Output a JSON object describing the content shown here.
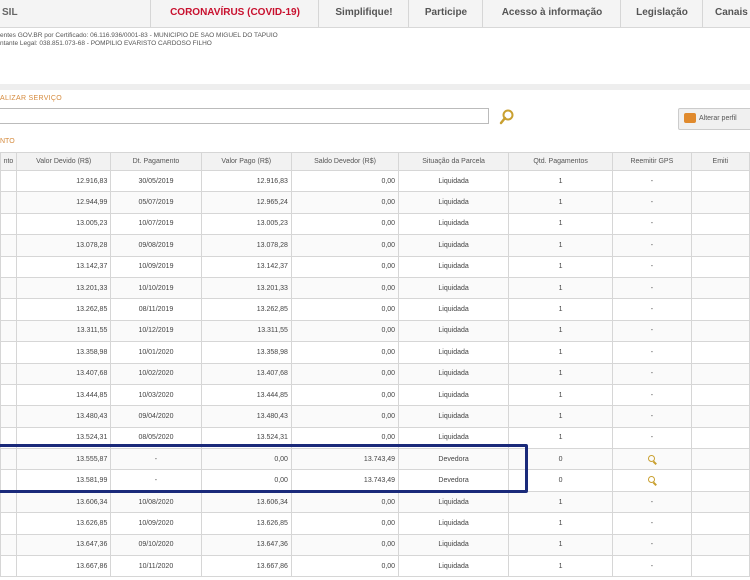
{
  "nav": {
    "brasil": "SIL",
    "coronavirus": "CORONAVÍRUS (COVID-19)",
    "simplifique": "Simplifique!",
    "participe": "Participe",
    "acesso": "Acesso à informação",
    "legislacao": "Legislação",
    "canais": "Canais"
  },
  "certificate": {
    "line1": "entes GOV.BR por Certificado: 06.116.936/0001-83 - MUNICIPIO DE SAO MIGUEL DO TAPUIO",
    "line2": "ntante Legal: 038.851.073-68 - POMPILIO EVARISTO CARDOSO FILHO"
  },
  "section_title": "ALIZAR SERVIÇO",
  "search": {
    "value": "",
    "placeholder": ""
  },
  "alter_button_label": "Alterar perfil",
  "section_sub": "NTO",
  "table": {
    "headers": [
      "nto",
      "Valor Devido (R$)",
      "Dt. Pagamento",
      "Valor Pago (R$)",
      "Saldo Devedor (R$)",
      "Situação da Parcela",
      "Qtd. Pagamentos",
      "Reemitir GPS",
      "Emiti"
    ],
    "rows": [
      [
        "",
        "12.916,83",
        "30/05/2019",
        "12.916,83",
        "0,00",
        "Liquidada",
        "1",
        "-",
        ""
      ],
      [
        "",
        "12.944,99",
        "05/07/2019",
        "12.965,24",
        "0,00",
        "Liquidada",
        "1",
        "-",
        ""
      ],
      [
        "",
        "13.005,23",
        "10/07/2019",
        "13.005,23",
        "0,00",
        "Liquidada",
        "1",
        "-",
        ""
      ],
      [
        "",
        "13.078,28",
        "09/08/2019",
        "13.078,28",
        "0,00",
        "Liquidada",
        "1",
        "-",
        ""
      ],
      [
        "",
        "13.142,37",
        "10/09/2019",
        "13.142,37",
        "0,00",
        "Liquidada",
        "1",
        "-",
        ""
      ],
      [
        "",
        "13.201,33",
        "10/10/2019",
        "13.201,33",
        "0,00",
        "Liquidada",
        "1",
        "-",
        ""
      ],
      [
        "",
        "13.262,85",
        "08/11/2019",
        "13.262,85",
        "0,00",
        "Liquidada",
        "1",
        "-",
        ""
      ],
      [
        "",
        "13.311,55",
        "10/12/2019",
        "13.311,55",
        "0,00",
        "Liquidada",
        "1",
        "-",
        ""
      ],
      [
        "",
        "13.358,98",
        "10/01/2020",
        "13.358,98",
        "0,00",
        "Liquidada",
        "1",
        "-",
        ""
      ],
      [
        "",
        "13.407,68",
        "10/02/2020",
        "13.407,68",
        "0,00",
        "Liquidada",
        "1",
        "-",
        ""
      ],
      [
        "",
        "13.444,85",
        "10/03/2020",
        "13.444,85",
        "0,00",
        "Liquidada",
        "1",
        "-",
        ""
      ],
      [
        "",
        "13.480,43",
        "09/04/2020",
        "13.480,43",
        "0,00",
        "Liquidada",
        "1",
        "-",
        ""
      ],
      [
        "",
        "13.524,31",
        "08/05/2020",
        "13.524,31",
        "0,00",
        "Liquidada",
        "1",
        "-",
        ""
      ],
      [
        "",
        "13.555,87",
        "-",
        "0,00",
        "13.743,49",
        "Devedora",
        "0",
        "search-icon",
        ""
      ],
      [
        "",
        "13.581,99",
        "-",
        "0,00",
        "13.743,49",
        "Devedora",
        "0",
        "search-icon",
        ""
      ],
      [
        "",
        "13.606,34",
        "10/08/2020",
        "13.606,34",
        "0,00",
        "Liquidada",
        "1",
        "-",
        ""
      ],
      [
        "",
        "13.626,85",
        "10/09/2020",
        "13.626,85",
        "0,00",
        "Liquidada",
        "1",
        "-",
        ""
      ],
      [
        "",
        "13.647,36",
        "09/10/2020",
        "13.647,36",
        "0,00",
        "Liquidada",
        "1",
        "-",
        ""
      ],
      [
        "",
        "13.667,86",
        "10/11/2020",
        "13.667,86",
        "0,00",
        "Liquidada",
        "1",
        "-",
        ""
      ]
    ]
  },
  "colors": {
    "accent_orange": "#d58a3c",
    "nav_red": "#c8102e",
    "highlight": "#1a2a7a"
  }
}
